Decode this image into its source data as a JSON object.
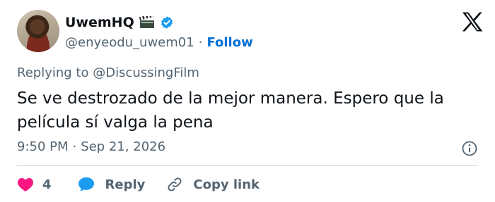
{
  "author": {
    "display_name": "UwemHQ",
    "handle": "@enyeodu_uwem01",
    "separator": "·",
    "follow_label": "Follow",
    "name_emoji": "clapper-board-icon",
    "verified": true
  },
  "reply_context": {
    "prefix": "Replying to",
    "mention": "@DiscussingFilm"
  },
  "tweet": {
    "text": "Se ve destrozado de la mejor manera. Espero que la película sí valga la pena",
    "time": "9:50 PM",
    "separator": "·",
    "date": "Sep 21, 2026"
  },
  "actions": {
    "like_count": "4",
    "reply_label": "Reply",
    "copy_link_label": "Copy link"
  },
  "colors": {
    "text": "#0f1419",
    "secondary": "#536471",
    "link": "#006fd6",
    "verified": "#1d9bf0",
    "like": "#f91880",
    "divider": "#cfd9de"
  }
}
